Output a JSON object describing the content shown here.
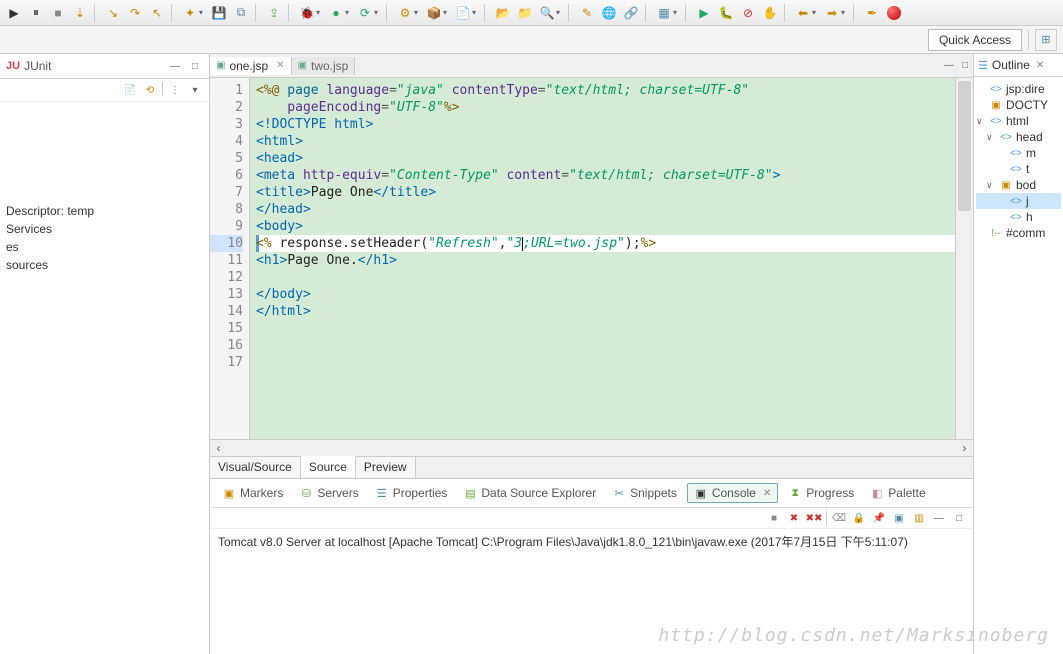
{
  "quick_access": "Quick Access",
  "left_view": {
    "prefix": "JU",
    "title": "JUnit"
  },
  "left_items": [
    "Descriptor: temp",
    " Services",
    "es",
    "sources"
  ],
  "tabs": [
    {
      "label": "one.jsp",
      "active": true
    },
    {
      "label": "two.jsp",
      "active": false
    }
  ],
  "line_numbers": [
    "1",
    "2",
    "3",
    "4",
    "5",
    "6",
    "7",
    "8",
    "9",
    "10",
    "11",
    "12",
    "13",
    "14",
    "15",
    "16",
    "17"
  ],
  "code": {
    "l1_a": "<%@",
    "l1_b": " page ",
    "l1_c": "language",
    "l1_d": "=",
    "l1_e": "\"java\"",
    "l1_f": " contentType",
    "l1_g": "=",
    "l1_h": "\"text/html; charset=UTF-8\"",
    "l2_a": "    pageEncoding",
    "l2_b": "=",
    "l2_c": "\"UTF-8\"",
    "l2_d": "%>",
    "l3": "<!DOCTYPE html>",
    "l4": "<html>",
    "l5": "<head>",
    "l6_a": "<meta ",
    "l6_b": "http-equiv",
    "l6_c": "=",
    "l6_d": "\"Content-Type\"",
    "l6_e": " content",
    "l6_f": "=",
    "l6_g": "\"text/html; charset=UTF-8\"",
    "l6_h": ">",
    "l7_a": "<title>",
    "l7_b": "Page One",
    "l7_c": "</title>",
    "l8": "</head>",
    "l9": "<body>",
    "l10_a": "<% ",
    "l10_b": "response.setHeader(",
    "l10_c": "\"Refresh\"",
    "l10_d": ",",
    "l10_e": "\"3",
    "l10_f": ";URL=two.jsp\"",
    "l10_g": ");",
    "l10_h": "%>",
    "l11_a": "<h1>",
    "l11_b": "Page One.",
    "l11_c": "</h1>",
    "l12": "",
    "l13": "</body>",
    "l14": "</html>"
  },
  "bottom_tabs": [
    "Visual/Source",
    "Source",
    "Preview"
  ],
  "bottom_active_index": 1,
  "views": [
    "Markers",
    "Servers",
    "Properties",
    "Data Source Explorer",
    "Snippets",
    "Console",
    "Progress",
    "Palette"
  ],
  "views_active_index": 5,
  "views_suffix": "✕",
  "console_text": "Tomcat v8.0 Server at localhost [Apache Tomcat] C:\\Program Files\\Java\\jdk1.8.0_121\\bin\\javaw.exe (2017年7月15日 下午5:11:07)",
  "outline_title": "Outline",
  "outline": {
    "i1": "jsp:dire",
    "i2": "DOCTY",
    "i3": "html",
    "i4": "head",
    "i5": "m",
    "i6": "t",
    "i7": "bod",
    "i8": "j",
    "i9": "h",
    "i10": "#comm"
  },
  "watermark": "http://blog.csdn.net/Marksinoberg"
}
